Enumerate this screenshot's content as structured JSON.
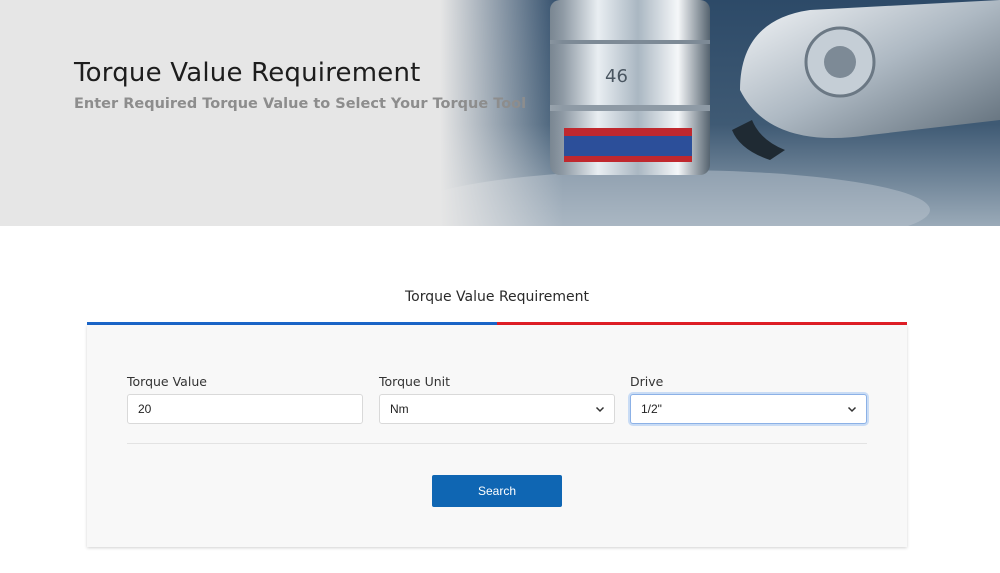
{
  "hero": {
    "title": "Torque Value Requirement",
    "subtitle": "Enter Required Torque Value to Select Your Torque Tool"
  },
  "section": {
    "title": "Torque Value Requirement",
    "accent_colors": [
      "#1b66c9",
      "#e01e26"
    ]
  },
  "form": {
    "torque_value": {
      "label": "Torque Value",
      "value": "20"
    },
    "torque_unit": {
      "label": "Torque Unit",
      "selected": "Nm"
    },
    "drive": {
      "label": "Drive",
      "selected": "1/2\""
    },
    "search_label": "Search"
  },
  "colors": {
    "button": "#0f66b3"
  }
}
